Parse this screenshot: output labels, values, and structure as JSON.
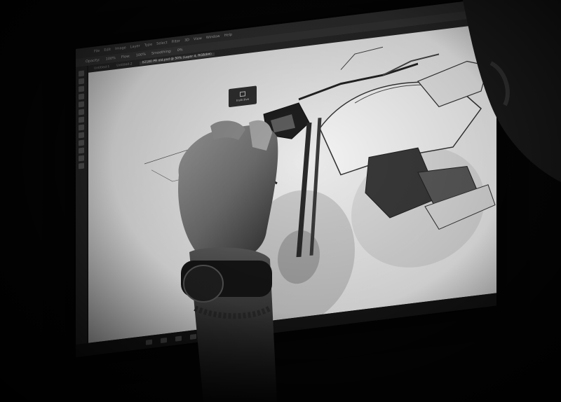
{
  "photo": {
    "subject": "designer sketching a motorcycle on a pen display in a dark room",
    "palette": {
      "background": "#050505",
      "screen": "#e6e6e6",
      "ui_dark": "#2b2b2b",
      "skin": "#8a8a8a"
    }
  },
  "app": {
    "menu_items": [
      "File",
      "Edit",
      "Image",
      "Layer",
      "Type",
      "Select",
      "Filter",
      "3D",
      "View",
      "Window",
      "Help"
    ],
    "options": [
      "Opacity:",
      "100%",
      "Flow:",
      "100%",
      "Smoothing:",
      "0%"
    ],
    "tabs": [
      "Untitled-1",
      "Untitled-2",
      "02180 PR old.psd @ 50% (Layer 4, RGB/8#)"
    ],
    "active_tab_index": 2,
    "popup_label": "Instictive"
  },
  "icons": {
    "toolbar": [
      "move-icon",
      "marquee-icon",
      "lasso-icon",
      "crop-icon",
      "eyedropper-icon",
      "brush-icon",
      "eraser-icon",
      "gradient-icon",
      "pen-icon",
      "text-icon",
      "shape-icon",
      "hand-icon",
      "zoom-icon"
    ],
    "taskbar": [
      "start-icon",
      "search-icon",
      "folder-icon",
      "browser-icon",
      "photoshop-icon",
      "mail-icon"
    ]
  }
}
